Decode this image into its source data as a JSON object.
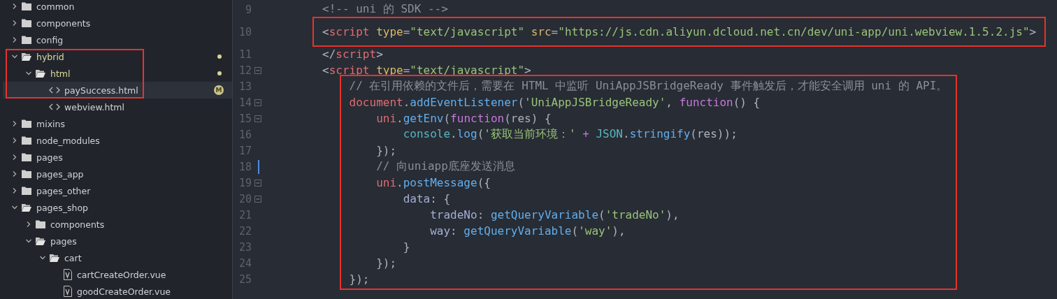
{
  "sidebar": {
    "items": [
      {
        "kind": "folder",
        "name": "common",
        "expanded": false,
        "selected": false
      },
      {
        "kind": "folder",
        "name": "components",
        "expanded": false,
        "selected": false
      },
      {
        "kind": "folder",
        "name": "config",
        "expanded": false,
        "selected": false
      },
      {
        "kind": "folder",
        "name": "hybrid",
        "expanded": true,
        "selected": false,
        "modified": true,
        "highlighted": true,
        "children": [
          {
            "kind": "folder",
            "name": "html",
            "expanded": true,
            "selected": false,
            "modified": true,
            "highlighted": true,
            "children": [
              {
                "kind": "html-file",
                "name": "paySuccess.html",
                "selected": true,
                "badge": "M",
                "highlighted": true
              },
              {
                "kind": "html-file",
                "name": "webview.html",
                "selected": false
              }
            ]
          }
        ]
      },
      {
        "kind": "folder",
        "name": "mixins",
        "expanded": false,
        "selected": false
      },
      {
        "kind": "folder",
        "name": "node_modules",
        "expanded": false,
        "selected": false
      },
      {
        "kind": "folder",
        "name": "pages",
        "expanded": false,
        "selected": false
      },
      {
        "kind": "folder",
        "name": "pages_app",
        "expanded": false,
        "selected": false
      },
      {
        "kind": "folder",
        "name": "pages_other",
        "expanded": false,
        "selected": false
      },
      {
        "kind": "folder",
        "name": "pages_shop",
        "expanded": true,
        "selected": false,
        "children": [
          {
            "kind": "folder",
            "name": "components",
            "expanded": false,
            "selected": false
          },
          {
            "kind": "folder",
            "name": "pages",
            "expanded": true,
            "selected": false,
            "children": [
              {
                "kind": "folder",
                "name": "cart",
                "expanded": true,
                "selected": false,
                "children": [
                  {
                    "kind": "vue-file",
                    "name": "cartCreateOrder.vue",
                    "selected": false
                  },
                  {
                    "kind": "vue-file",
                    "name": "goodCreateOrder.vue",
                    "selected": false
                  }
                ]
              }
            ]
          }
        ]
      }
    ]
  },
  "editor": {
    "lines": [
      {
        "number": "9",
        "tokens": [
          {
            "kind": "comment",
            "t": "        <!-- uni 的 SDK -->"
          }
        ]
      },
      {
        "number": "10",
        "highlighted": true,
        "tokens": [
          {
            "kind": "punct",
            "t": "        <"
          },
          {
            "kind": "tag",
            "t": "script"
          },
          {
            "kind": "attr",
            "t": " type"
          },
          {
            "kind": "punct",
            "t": "="
          },
          {
            "kind": "string",
            "t": "\"text/javascript\""
          },
          {
            "kind": "attr",
            "t": " src"
          },
          {
            "kind": "punct",
            "t": "="
          },
          {
            "kind": "string",
            "t": "\"https://js.cdn.aliyun.dcloud.net.cn/dev/uni-app/uni.webview.1.5.2.js\""
          },
          {
            "kind": "punct",
            "t": ">"
          }
        ]
      },
      {
        "number": "11",
        "tokens": [
          {
            "kind": "punct",
            "t": "        </"
          },
          {
            "kind": "tag",
            "t": "script"
          },
          {
            "kind": "punct",
            "t": ">"
          }
        ]
      },
      {
        "number": "12",
        "fold": true,
        "tokens": [
          {
            "kind": "punct",
            "t": "        <"
          },
          {
            "kind": "tag",
            "t": "script"
          },
          {
            "kind": "attr",
            "t": " type"
          },
          {
            "kind": "punct",
            "t": "="
          },
          {
            "kind": "string",
            "t": "\"text/javascript\""
          },
          {
            "kind": "punct",
            "t": ">"
          }
        ]
      },
      {
        "number": "13",
        "highlighted": true,
        "tokens": [
          {
            "kind": "comment",
            "t": "            // 在引用依赖的文件后，需要在 HTML 中监听 UniAppJSBridgeReady 事件触发后，才能安全调用 uni 的 API。"
          }
        ]
      },
      {
        "number": "14",
        "fold": true,
        "highlighted": true,
        "tokens": [
          {
            "kind": "var",
            "t": "            document"
          },
          {
            "kind": "punct",
            "t": "."
          },
          {
            "kind": "method",
            "t": "addEventListener"
          },
          {
            "kind": "punct",
            "t": "("
          },
          {
            "kind": "string",
            "t": "'UniAppJSBridgeReady'"
          },
          {
            "kind": "punct",
            "t": ", "
          },
          {
            "kind": "keyword",
            "t": "function"
          },
          {
            "kind": "punct",
            "t": "() {"
          }
        ]
      },
      {
        "number": "15",
        "fold": true,
        "highlighted": true,
        "tokens": [
          {
            "kind": "var",
            "t": "                uni"
          },
          {
            "kind": "punct",
            "t": "."
          },
          {
            "kind": "method",
            "t": "getEnv"
          },
          {
            "kind": "punct",
            "t": "("
          },
          {
            "kind": "keyword",
            "t": "function"
          },
          {
            "kind": "punct",
            "t": "(res) {"
          }
        ]
      },
      {
        "number": "16",
        "highlighted": true,
        "tokens": [
          {
            "kind": "builtin",
            "t": "                    console"
          },
          {
            "kind": "punct",
            "t": "."
          },
          {
            "kind": "method",
            "t": "log"
          },
          {
            "kind": "punct",
            "t": "("
          },
          {
            "kind": "string",
            "t": "'获取当前环境：'"
          },
          {
            "kind": "operator",
            "t": " + "
          },
          {
            "kind": "builtin",
            "t": "JSON"
          },
          {
            "kind": "punct",
            "t": "."
          },
          {
            "kind": "method",
            "t": "stringify"
          },
          {
            "kind": "punct",
            "t": "(res));"
          }
        ]
      },
      {
        "number": "17",
        "highlighted": true,
        "tokens": [
          {
            "kind": "punct",
            "t": "                });"
          }
        ]
      },
      {
        "number": "18",
        "changed": true,
        "highlighted": true,
        "tokens": [
          {
            "kind": "comment",
            "t": "                // 向uniapp底座发送消息"
          }
        ]
      },
      {
        "number": "19",
        "fold": true,
        "highlighted": true,
        "tokens": [
          {
            "kind": "var",
            "t": "                uni"
          },
          {
            "kind": "punct",
            "t": "."
          },
          {
            "kind": "method",
            "t": "postMessage"
          },
          {
            "kind": "punct",
            "t": "({"
          }
        ]
      },
      {
        "number": "20",
        "fold": true,
        "highlighted": true,
        "tokens": [
          {
            "kind": "prop",
            "t": "                    data"
          },
          {
            "kind": "punct",
            "t": ": {"
          }
        ]
      },
      {
        "number": "21",
        "highlighted": true,
        "tokens": [
          {
            "kind": "prop",
            "t": "                        tradeNo"
          },
          {
            "kind": "punct",
            "t": ": "
          },
          {
            "kind": "method",
            "t": "getQueryVariable"
          },
          {
            "kind": "punct",
            "t": "("
          },
          {
            "kind": "string",
            "t": "'tradeNo'"
          },
          {
            "kind": "punct",
            "t": "),"
          }
        ]
      },
      {
        "number": "22",
        "highlighted": true,
        "tokens": [
          {
            "kind": "prop",
            "t": "                        way"
          },
          {
            "kind": "punct",
            "t": ": "
          },
          {
            "kind": "method",
            "t": "getQueryVariable"
          },
          {
            "kind": "punct",
            "t": "("
          },
          {
            "kind": "string",
            "t": "'way'"
          },
          {
            "kind": "punct",
            "t": "),"
          }
        ]
      },
      {
        "number": "23",
        "highlighted": true,
        "tokens": [
          {
            "kind": "punct",
            "t": "                    }"
          }
        ]
      },
      {
        "number": "24",
        "highlighted": true,
        "tokens": [
          {
            "kind": "punct",
            "t": "                });"
          }
        ]
      },
      {
        "number": "25",
        "highlighted": true,
        "tokens": [
          {
            "kind": "punct",
            "t": "            });"
          }
        ]
      }
    ]
  }
}
